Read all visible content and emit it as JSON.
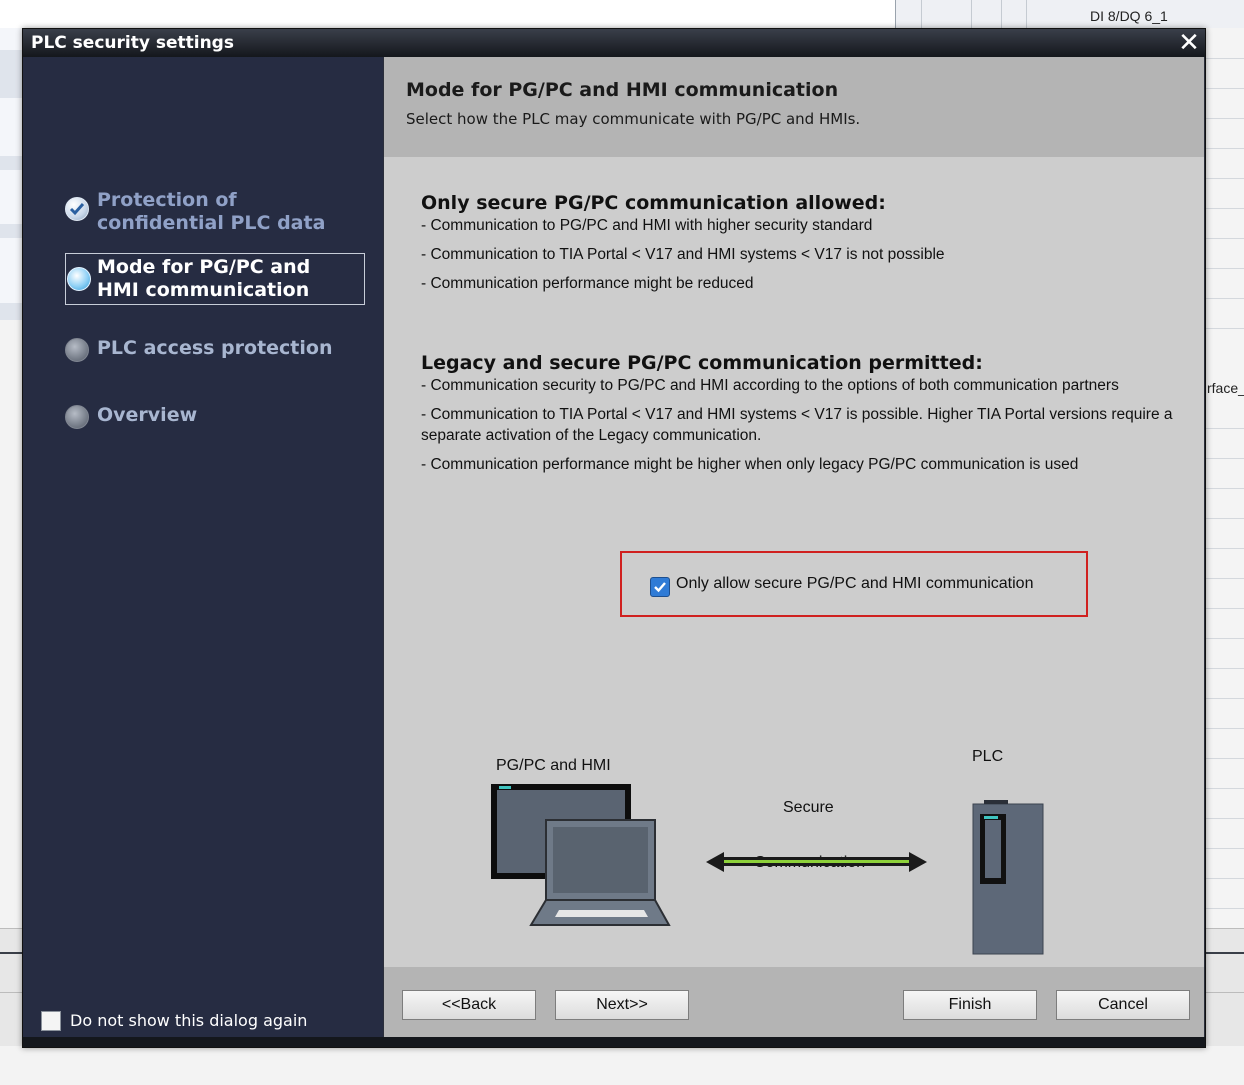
{
  "background": {
    "table_cell_label": "DI 8/DQ 6_1",
    "right_label": "rface_"
  },
  "dialog": {
    "title": "PLC security settings",
    "close_symbol": "✕"
  },
  "nav": {
    "items": [
      {
        "label": "Protection of confidential PLC data",
        "state": "done"
      },
      {
        "label": "Mode for PG/PC and HMI communication",
        "state": "active"
      },
      {
        "label": "PLC access protection",
        "state": "todo"
      },
      {
        "label": "Overview",
        "state": "todo"
      }
    ],
    "dont_show_label": "Do not show this dialog again",
    "dont_show_checked": false
  },
  "header": {
    "title": "Mode for PG/PC and HMI communication",
    "subtitle": "Select how the PLC may communicate with PG/PC and HMIs."
  },
  "secure_section": {
    "heading": "Only secure PG/PC communication allowed:",
    "lines": [
      "- Communication to PG/PC and HMI with higher security standard",
      "- Communication to TIA Portal < V17 and HMI systems < V17 is not possible",
      "- Communication performance might be reduced"
    ]
  },
  "legacy_section": {
    "heading": "Legacy and secure PG/PC communication permitted:",
    "lines": [
      "- Communication security to PG/PC and HMI according to the options of both communication partners",
      "- Communication to TIA Portal < V17 and HMI systems < V17 is possible. Higher TIA Portal versions require a separate activation of the Legacy communication.",
      "- Communication performance might be higher when only legacy PG/PC communication is used"
    ]
  },
  "secure_checkbox": {
    "label": "Only allow secure PG/PC and HMI communication",
    "checked": true
  },
  "diagram": {
    "left_label": "PG/PC and HMI",
    "right_label": "PLC",
    "arrow_top": "Secure",
    "arrow_bottom": "Communication"
  },
  "footer": {
    "back": "<<Back",
    "next": "Next>>",
    "finish": "Finish",
    "cancel": "Cancel"
  },
  "colors": {
    "nav_bg": "#262c42",
    "content_bg": "#cdcdcd",
    "highlight_border": "#d0201f",
    "link_green": "#8dd13a"
  }
}
